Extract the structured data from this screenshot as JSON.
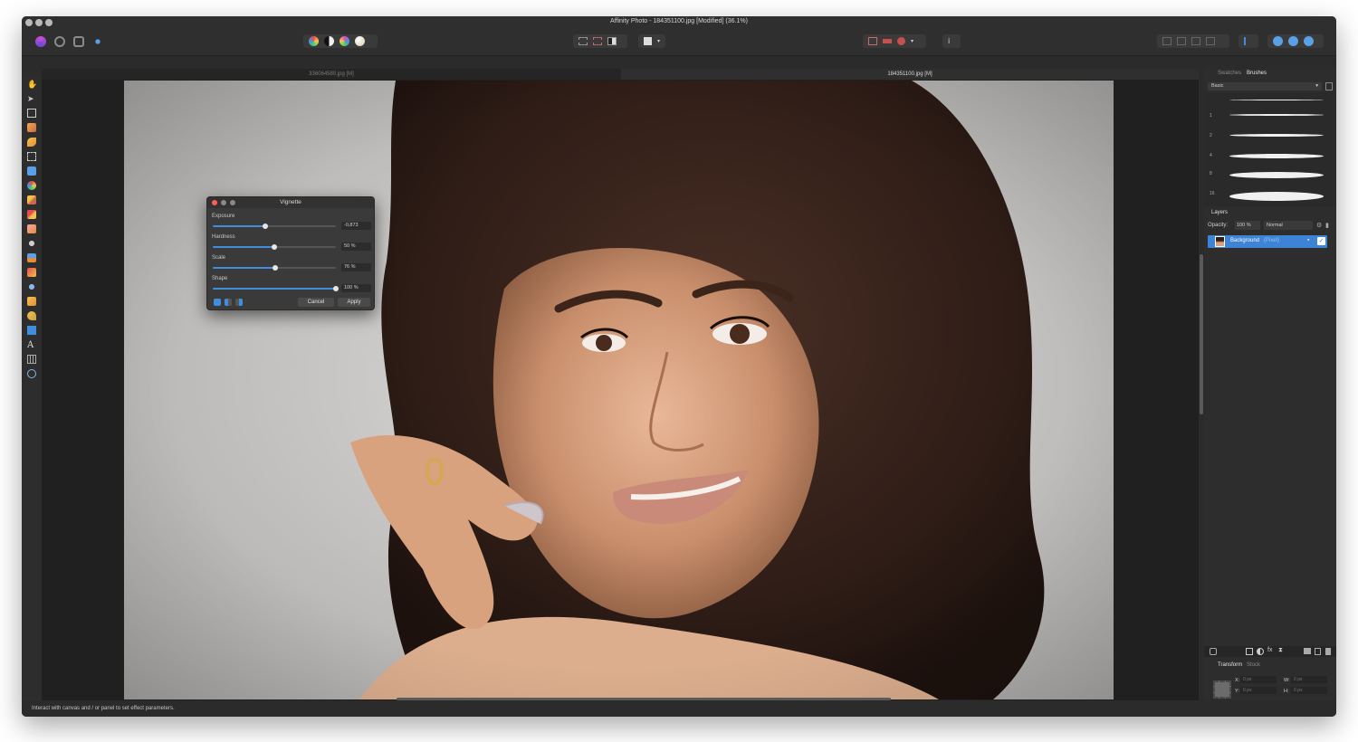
{
  "window": {
    "title": "Affinity Photo - 184351100.jpg [Modified] (36.1%)"
  },
  "tabs": [
    {
      "label": "336064580.jpg [M]"
    },
    {
      "label": "184351100.jpg [M]"
    }
  ],
  "toolbar": {
    "personas": [
      "photo-persona-icon",
      "liquify-persona-icon",
      "develop-persona-icon",
      "export-persona-icon"
    ],
    "adjust_buttons": [
      "auto-levels-icon",
      "auto-contrast-icon",
      "auto-colour-icon",
      "auto-white-balance-icon"
    ]
  },
  "dialog": {
    "title": "Vignette",
    "sliders": [
      {
        "label": "Exposure",
        "value": "-0,873",
        "fraction": 0.43
      },
      {
        "label": "Hardness",
        "value": "50 %",
        "fraction": 0.5
      },
      {
        "label": "Scale",
        "value": "76 %",
        "fraction": 0.51
      },
      {
        "label": "Shape",
        "value": "100 %",
        "fraction": 1.0
      }
    ],
    "cancel_label": "Cancel",
    "apply_label": "Apply"
  },
  "panels": {
    "swatches_tab": "Swatches",
    "brushes_tab": "Brushes",
    "brush_category": "Basic",
    "brush_sizes": [
      "1",
      "2",
      "4",
      "8",
      "16"
    ],
    "layers_title": "Layers",
    "opacity_label": "Opacity:",
    "opacity_value": "100 %",
    "blend_mode": "Normal",
    "layer_name": "Background",
    "layer_type": "(Pixel)",
    "transform_tab": "Transform",
    "stock_tab": "Stock",
    "transform": {
      "x_label": "X:",
      "x_value": "0 px",
      "y_label": "Y:",
      "y_value": "0 px",
      "w_label": "W:",
      "w_value": "0 px",
      "h_label": "H:",
      "h_value": "0 px",
      "r_label": "R:",
      "r_value": "0 °",
      "s_label": "S:",
      "s_value": "0 °"
    }
  },
  "status_text": "Interact with canvas and / or panel to set effect parameters.",
  "colors": {
    "accent": "#3f8ddb",
    "window_bg": "#2b2b2b",
    "panel_bg": "#2d2d2d",
    "close_button": "#ff5f57"
  }
}
